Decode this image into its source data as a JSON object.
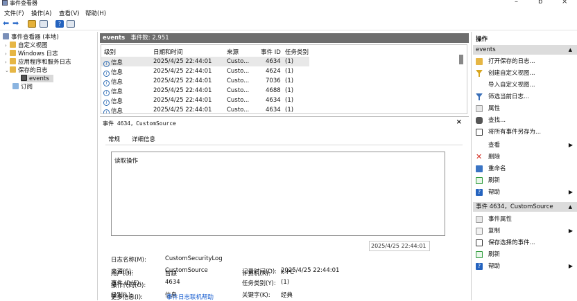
{
  "window": {
    "title": "事件查看器",
    "min": "–",
    "max": "ɒ",
    "close": "×"
  },
  "menu": [
    "文件(F)",
    "操作(A)",
    "查看(V)",
    "帮助(H)"
  ],
  "tree": {
    "root": "事件查看器 (本地)",
    "items": [
      "自定义视图",
      "Windows 日志",
      "应用程序和服务日志",
      "保存的日志",
      "events",
      "订阅"
    ]
  },
  "center": {
    "log_name": "events",
    "event_count": "事件数: 2,951",
    "columns": [
      "级别",
      "日期和时间",
      "来源",
      "事件 ID",
      "任务类别"
    ],
    "rows": [
      {
        "level": "信息",
        "datetime": "2025/4/25 22:44:01",
        "source": "Custo...",
        "id": "4634",
        "task": "(1)"
      },
      {
        "level": "信息",
        "datetime": "2025/4/25 22:44:01",
        "source": "Custo...",
        "id": "4624",
        "task": "(1)"
      },
      {
        "level": "信息",
        "datetime": "2025/4/25 22:44:01",
        "source": "Custo...",
        "id": "7036",
        "task": "(1)"
      },
      {
        "level": "信息",
        "datetime": "2025/4/25 22:44:01",
        "source": "Custo...",
        "id": "4688",
        "task": "(1)"
      },
      {
        "level": "信息",
        "datetime": "2025/4/25 22:44:01",
        "source": "Custo...",
        "id": "4634",
        "task": "(1)"
      },
      {
        "level": "信息",
        "datetime": "2025/4/25 22:44:01",
        "source": "Custo...",
        "id": "4634",
        "task": "(1)"
      }
    ]
  },
  "detail": {
    "title": "事件 4634，CustomSource",
    "tabs": [
      "常规",
      "详细信息"
    ],
    "description": "读取操作",
    "tooltip": "2025/4/25 22:44:01",
    "fields": {
      "log_name": {
        "label": "日志名称(M):",
        "value": "CustomSecurityLog"
      },
      "source": {
        "label": "来源(S):",
        "value": "CustomSource"
      },
      "logged": {
        "label": "记录时间(D):",
        "value": "2025/4/25 22:44:01"
      },
      "event_id": {
        "label": "事件 ID(E):",
        "value": "4634"
      },
      "task": {
        "label": "任务类别(Y):",
        "value": "(1)"
      },
      "level": {
        "label": "级别(L):",
        "value": "信息"
      },
      "keywords": {
        "label": "关键字(K):",
        "value": "经典"
      },
      "user": {
        "label": "用户(U):",
        "value": "暂缺"
      },
      "computer": {
        "label": "计算机(R):",
        "value": "k-PC"
      },
      "opcode": {
        "label": "操作代码(O):",
        "value": ""
      },
      "more_info": {
        "label": "更多信息(I):",
        "value": "事件日志联机帮助"
      }
    }
  },
  "actions": {
    "header": "操作",
    "section1": "events",
    "items1": [
      "打开保存的日志...",
      "创建自定义视图...",
      "导入自定义视图...",
      "筛选当前日志...",
      "属性",
      "查找...",
      "将所有事件另存为...",
      "查看",
      "删除",
      "重命名",
      "刷新",
      "帮助"
    ],
    "section2": "事件 4634，CustomSource",
    "items2": [
      "事件属性",
      "复制",
      "保存选择的事件...",
      "刷新",
      "帮助"
    ]
  },
  "colors": {
    "header_bg": "#6d6d6d",
    "section_bg": "#dcdcdc",
    "link": "#1a5fd0"
  }
}
